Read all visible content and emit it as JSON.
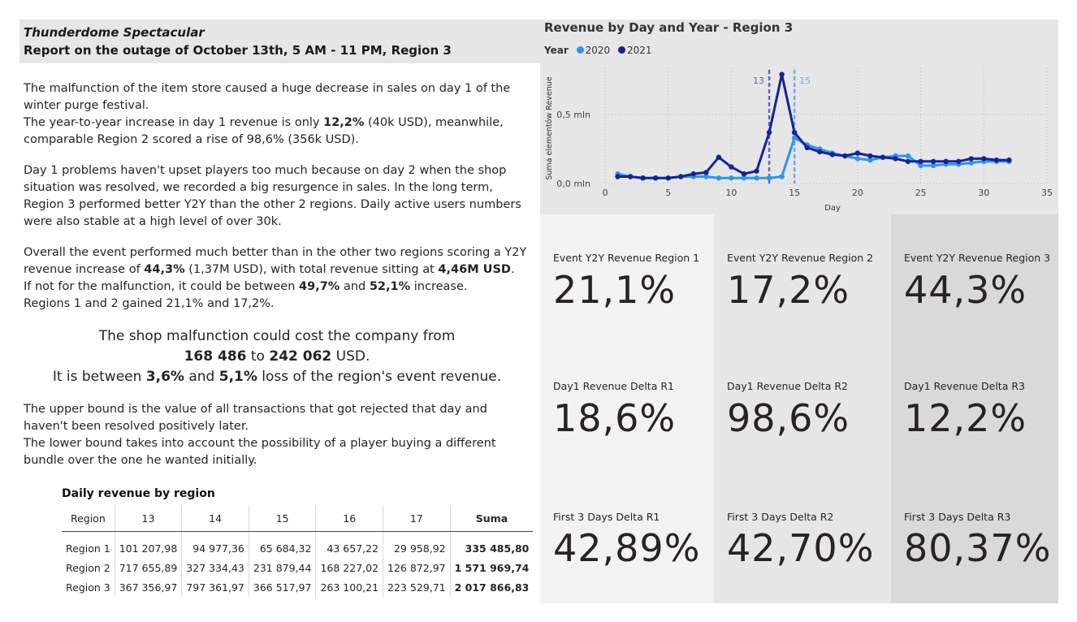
{
  "header": {
    "title": "Thunderdome Spectacular",
    "subtitle": "Report on the outage of October 13th, 5 AM - 11 PM, Region 3"
  },
  "text": {
    "p1_a": "The malfunction of the item store caused a huge decrease in sales on day 1 of the winter purge festival.",
    "p1_b_pre": "The year-to-year increase in day 1 revenue is only ",
    "p1_b_bold": "12,2%",
    "p1_b_post": " (40k USD), meanwhile, comparable Region 2 scored a rise of 98,6% (356k USD).",
    "p2": "Day 1 problems haven't upset players too much because on day 2 when the shop situation was resolved, we recorded a big resurgence in sales. In the long term, Region 3 performed better Y2Y than the other 2 regions. Daily active users numbers were also stable at a high level of over 30k.",
    "p3_a_pre": "Overall the event performed much better than in the other two regions scoring a Y2Y revenue increase of ",
    "p3_a_bold1": "44,3%",
    "p3_a_mid": " (1,37M USD), with total revenue sitting at ",
    "p3_a_bold2": "4,46M USD",
    "p3_a_post": ".",
    "p3_b_pre": "If not for the malfunction, it could be between ",
    "p3_b_bold1": "49,7%",
    "p3_b_mid": " and ",
    "p3_b_bold2": "52,1%",
    "p3_b_post": " increase.",
    "p3_c": "Regions 1 and 2 gained 21,1% and 17,2%.",
    "callout_1": "The shop malfunction could cost the company from",
    "callout_2_bold1": "168 486",
    "callout_2_mid": " to ",
    "callout_2_bold2": "242 062",
    "callout_2_post": " USD.",
    "callout_3_pre": "It is between ",
    "callout_3_bold1": "3,6%",
    "callout_3_mid": " and ",
    "callout_3_bold2": "5,1%",
    "callout_3_post": " loss of the region's event revenue.",
    "p4_a": "The upper bound is the value of all transactions that got rejected that day and haven't been resolved positively later.",
    "p4_b": "The lower bound takes into account the possibility of a player buying a different bundle over the one he wanted initially."
  },
  "table": {
    "title": "Daily revenue by region",
    "headers": [
      "Region",
      "13",
      "14",
      "15",
      "16",
      "17",
      "Suma"
    ],
    "rows": [
      [
        "Region 1",
        "101 207,98",
        "94 977,36",
        "65 684,32",
        "43 657,22",
        "29 958,92",
        "335 485,80"
      ],
      [
        "Region 2",
        "717 655,89",
        "327 334,43",
        "231 879,44",
        "168 227,02",
        "126 872,97",
        "1 571 969,74"
      ],
      [
        "Region 3",
        "367 356,97",
        "797 361,97",
        "366 517,97",
        "263 100,21",
        "223 529,71",
        "2 017 866,83"
      ]
    ]
  },
  "chart_data": {
    "type": "line",
    "title": "Revenue by Day and Year - Region 3",
    "legend_title": "Year",
    "xlabel": "Day",
    "ylabel": "Suma elementów Revenue",
    "xlim": [
      0,
      35
    ],
    "ylim": [
      0,
      0.8
    ],
    "x_ticks": [
      "0",
      "5",
      "10",
      "15",
      "20",
      "25",
      "30",
      "35"
    ],
    "y_ticks": [
      {
        "v": 0,
        "label": "0,0 mln"
      },
      {
        "v": 0.5,
        "label": "0,5 mln"
      }
    ],
    "reference_lines": [
      {
        "x": 13,
        "label": "13"
      },
      {
        "x": 15,
        "label": "15"
      }
    ],
    "series": [
      {
        "name": "2020",
        "color": "#2b95ef",
        "x": [
          1,
          2,
          3,
          4,
          5,
          6,
          7,
          8,
          9,
          10,
          11,
          12,
          13,
          14,
          15,
          16,
          17,
          18,
          19,
          20,
          21,
          22,
          23,
          24,
          25,
          26,
          27,
          28,
          29,
          30,
          31,
          32
        ],
        "values": [
          0.07,
          0.05,
          0.04,
          0.04,
          0.04,
          0.05,
          0.05,
          0.05,
          0.04,
          0.04,
          0.04,
          0.04,
          0.04,
          0.05,
          0.33,
          0.28,
          0.25,
          0.22,
          0.2,
          0.18,
          0.17,
          0.19,
          0.2,
          0.2,
          0.13,
          0.13,
          0.14,
          0.14,
          0.15,
          0.16,
          0.16,
          0.16
        ]
      },
      {
        "name": "2021",
        "color": "#12239e",
        "x": [
          1,
          2,
          3,
          4,
          5,
          6,
          7,
          8,
          9,
          10,
          11,
          12,
          13,
          14,
          15,
          16,
          17,
          18,
          19,
          20,
          21,
          22,
          23,
          24,
          25,
          26,
          27,
          28,
          29,
          30,
          31,
          32
        ],
        "values": [
          0.05,
          0.05,
          0.04,
          0.04,
          0.04,
          0.05,
          0.07,
          0.08,
          0.19,
          0.12,
          0.07,
          0.09,
          0.37,
          0.79,
          0.37,
          0.26,
          0.23,
          0.21,
          0.2,
          0.22,
          0.2,
          0.19,
          0.18,
          0.16,
          0.16,
          0.16,
          0.16,
          0.16,
          0.18,
          0.18,
          0.17,
          0.17
        ]
      }
    ]
  },
  "cards": [
    {
      "label": "Event Y2Y Revenue Region 1",
      "value": "21,1%",
      "bg": "#f2f2f2"
    },
    {
      "label": "Event Y2Y Revenue Region 2",
      "value": "17,2%",
      "bg": "#e6e6e6"
    },
    {
      "label": "Event Y2Y Revenue Region 3",
      "value": "44,3%",
      "bg": "#d9d9d9"
    },
    {
      "label": "Day1 Revenue Delta R1",
      "value": "18,6%",
      "bg": "#f2f2f2"
    },
    {
      "label": "Day1 Revenue Delta R2",
      "value": "98,6%",
      "bg": "#e6e6e6"
    },
    {
      "label": "Day1 Revenue Delta R3",
      "value": "12,2%",
      "bg": "#d9d9d9"
    },
    {
      "label": "First 3 Days Delta R1",
      "value": "42,89%",
      "bg": "#f2f2f2"
    },
    {
      "label": "First 3 Days Delta R2",
      "value": "42,70%",
      "bg": "#e6e6e6"
    },
    {
      "label": "First 3 Days Delta R3",
      "value": "80,37%",
      "bg": "#d9d9d9"
    }
  ]
}
